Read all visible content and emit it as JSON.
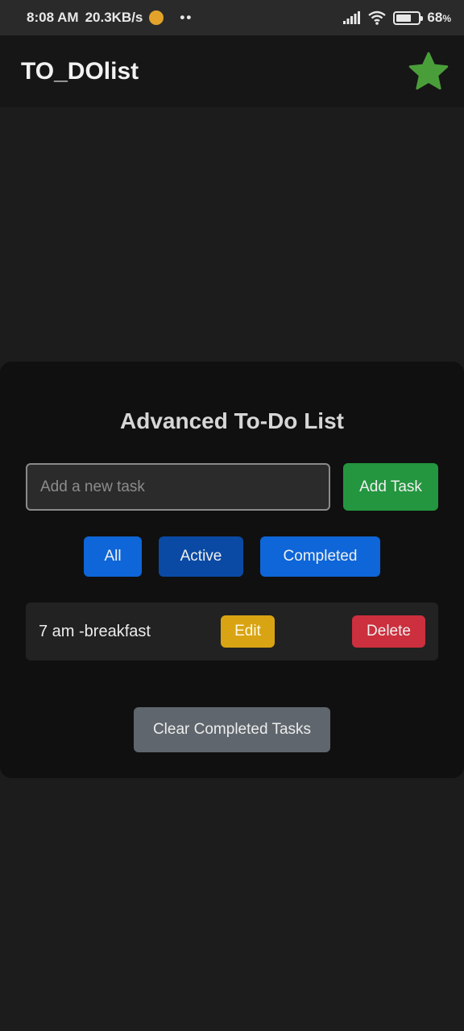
{
  "status_bar": {
    "time": "8:08 AM",
    "speed": "20.3KB/s",
    "dots": "••",
    "battery_percent": "68",
    "battery_suffix": "%",
    "battery_level": 0.68
  },
  "app_bar": {
    "title": "TO_DOlist",
    "star_icon": "star-icon",
    "star_color": "#4a9e3a"
  },
  "card": {
    "title": "Advanced To-Do List",
    "input_placeholder": "Add a new task",
    "input_value": "",
    "add_label": "Add Task",
    "filters": [
      {
        "label": "All",
        "selected": false
      },
      {
        "label": "Active",
        "selected": true
      },
      {
        "label": "Completed",
        "selected": false
      }
    ],
    "tasks": [
      {
        "text": "7 am -breakfast",
        "edit_label": "Edit",
        "delete_label": "Delete"
      }
    ],
    "clear_label": "Clear Completed Tasks"
  },
  "colors": {
    "background": "#1c1c1c",
    "card": "#101010",
    "add": "#23963f",
    "filter": "#0e66d8",
    "filter_active": "#0a4aa4",
    "edit": "#d9a413",
    "delete": "#cc2f3d",
    "clear": "#5f666d"
  }
}
